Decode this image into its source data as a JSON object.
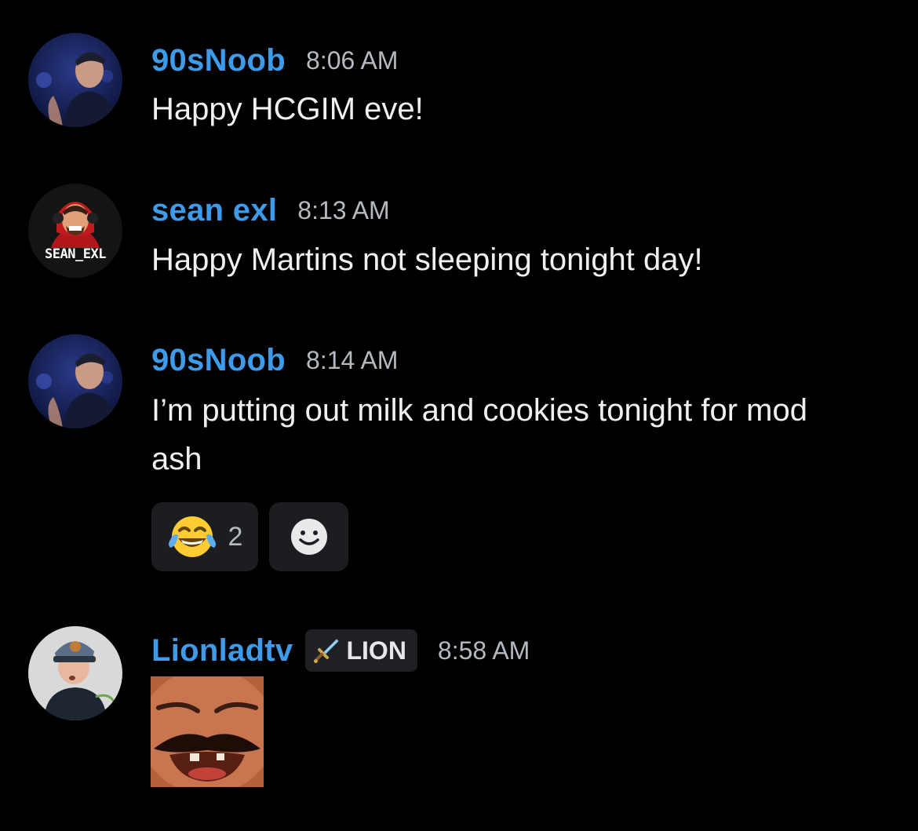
{
  "messages": [
    {
      "username": "90sNoob",
      "timestamp": "8:06 AM",
      "text": "Happy HCGIM eve!",
      "avatar_icon": "user-photo-avatar"
    },
    {
      "username": "sean exl",
      "timestamp": "8:13 AM",
      "text": "Happy Martins not sleeping tonight day!",
      "avatar_icon": "gamer-logo-avatar",
      "avatar_text": "SEAN_EXL"
    },
    {
      "username": "90sNoob",
      "timestamp": "8:14 AM",
      "text": "I’m putting out milk and cookies tonight for mod ash",
      "avatar_icon": "user-photo-avatar",
      "reactions": [
        {
          "emoji_icon": "tears-of-joy-emoji",
          "count": "2"
        }
      ],
      "add_reaction_icon": "add-reaction-smiley-icon"
    },
    {
      "username": "Lionladtv",
      "role_tag": "LION",
      "role_icon": "sword-icon",
      "timestamp": "8:58 AM",
      "avatar_icon": "user-photo-avatar",
      "attachment": "laughing-face-gif"
    }
  ],
  "colors": {
    "background": "#000000",
    "username": "#3d9be9",
    "message_text": "#eef0f2",
    "timestamp": "#b5bac1",
    "reaction_bg": "#1c1d21"
  }
}
